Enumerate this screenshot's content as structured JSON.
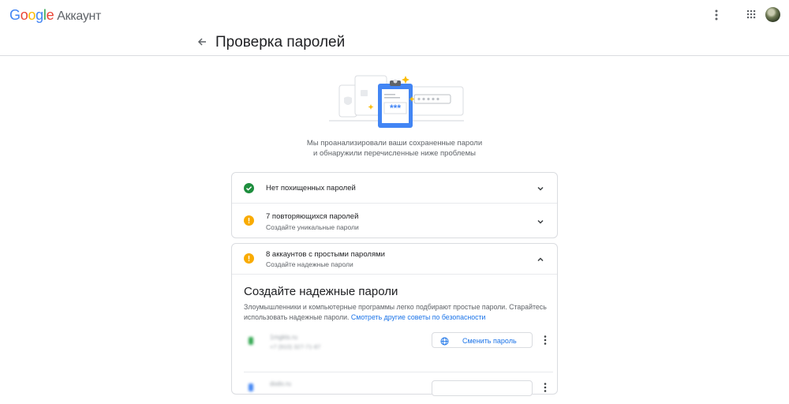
{
  "header": {
    "logo_google": [
      "G",
      "o",
      "o",
      "g",
      "l",
      "e"
    ],
    "logo_product": "Аккаунт",
    "more_icon": "more-vert-icon",
    "apps_icon": "apps-grid-icon",
    "avatar": "account-avatar"
  },
  "page": {
    "title": "Проверка паролей",
    "back_icon": "arrow-back-icon",
    "intro_line1": "Мы проанализировали ваши сохраненные пароли",
    "intro_line2": "и обнаружили перечисленные ниже проблемы",
    "illustration_password_mask": "***"
  },
  "checks": [
    {
      "title": "Нет похищенных паролей",
      "subtitle": "",
      "status": "ok",
      "expanded": false
    },
    {
      "title": "7 повторяющихся паролей",
      "subtitle": "Создайте уникальные пароли",
      "status": "warning",
      "expanded": false
    },
    {
      "title": "8 аккаунтов с простыми паролями",
      "subtitle": "Создайте надежные пароли",
      "status": "warning",
      "expanded": true
    }
  ],
  "weak_section": {
    "title": "Создайте надежные пароли",
    "desc": "Злоумышленники и компьютерные программы легко подбирают простые пароли. Старайтесь использовать надежные пароли.",
    "link": "Смотреть другие советы по безопасности"
  },
  "accounts": [
    {
      "site": "hidden (blurred)",
      "user": "hidden (blurred)",
      "action": "Сменить пароль",
      "site_icon_color": "#34a853"
    },
    {
      "site": "hidden (blurred)",
      "user": "",
      "action": "",
      "site_icon_color": "#4285f4"
    }
  ],
  "colors": {
    "ok": "#1e8e3e",
    "warning": "#f9ab00",
    "link": "#1a73e8",
    "accent_blue": "#4285f4"
  }
}
